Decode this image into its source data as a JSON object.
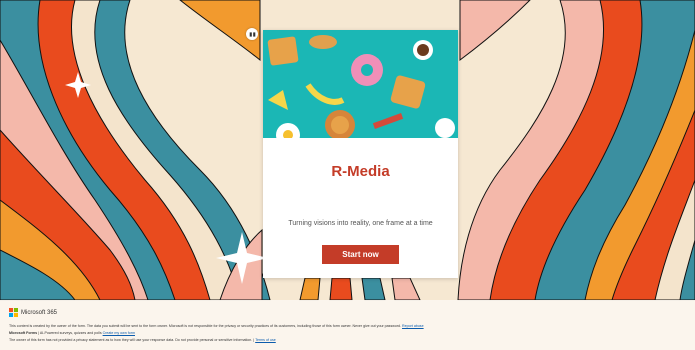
{
  "form": {
    "title": "R-Media",
    "subtitle": "Turning visions into reality, one frame at a time",
    "start_button": "Start now"
  },
  "footer": {
    "brand": "Microsoft 365",
    "disclaimer": "This content is created by the owner of the form. The data you submit will be sent to the form owner. Microsoft is not responsible for the privacy or security practices of its customers, including those of this form owner. Never give out your password.",
    "report_abuse": "Report abuse",
    "forms_name": "Microsoft Forms",
    "forms_tagline": " | AI-Powered surveys, quizzes and polls ",
    "create_form": "Create my own form",
    "privacy_text": "The owner of this form has not provided a privacy statement as to how they will use your response data. Do not provide personal or sensitive information.",
    "terms_sep": " | ",
    "terms": "Terms of use"
  },
  "colors": {
    "accent": "#c43c28",
    "teal": "#1bb7b5",
    "stripe_red": "#e94b1e",
    "stripe_orange": "#f29a2e",
    "stripe_pink": "#f4b8aa",
    "stripe_blue": "#3b8fa0",
    "stripe_cream": "#f4e4cc"
  },
  "icons": {
    "immersive_reader": "immersive-reader-icon",
    "sparkle": "sparkle-icon"
  }
}
